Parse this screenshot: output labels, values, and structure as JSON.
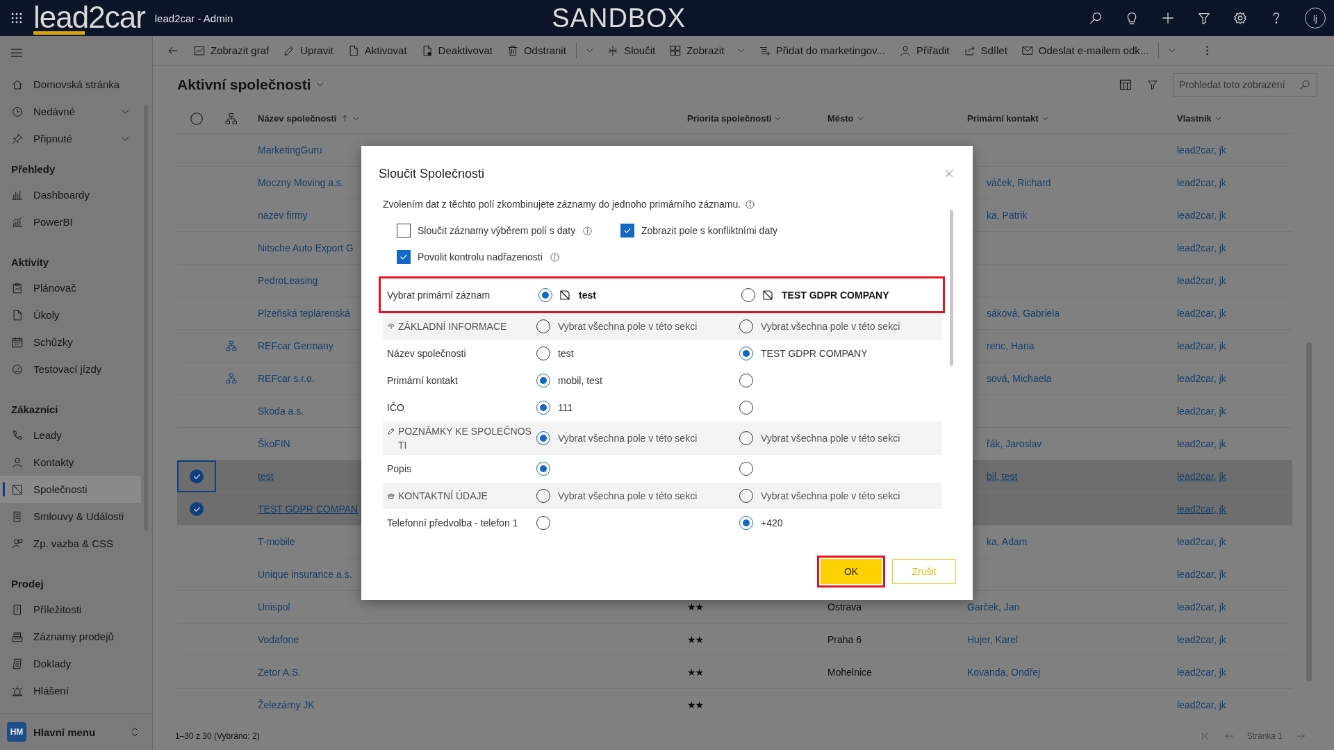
{
  "top_bar": {
    "logo": "lead2car",
    "app_title": "lead2car - Admin",
    "environment": "SANDBOX",
    "avatar": "lj"
  },
  "sidebar": {
    "sections": [
      {
        "items": [
          {
            "label": "Domovská stránka",
            "kind": "link",
            "selected": false
          },
          {
            "label": "Nedávné",
            "kind": "group",
            "selected": false
          },
          {
            "label": "Připnuté",
            "kind": "group",
            "selected": false
          }
        ]
      },
      {
        "title": "Přehledy",
        "items": [
          {
            "label": "Dashboardy",
            "kind": "link",
            "selected": false
          },
          {
            "label": "PowerBI",
            "kind": "link",
            "selected": false
          }
        ]
      },
      {
        "title": "Aktivity",
        "items": [
          {
            "label": "Plánovač",
            "kind": "link",
            "selected": false
          },
          {
            "label": "Úkoly",
            "kind": "link",
            "selected": false
          },
          {
            "label": "Schůzky",
            "kind": "link",
            "selected": false
          },
          {
            "label": "Testovací jízdy",
            "kind": "link",
            "selected": false
          }
        ]
      },
      {
        "title": "Zákazníci",
        "items": [
          {
            "label": "Leady",
            "kind": "link",
            "selected": false
          },
          {
            "label": "Kontakty",
            "kind": "link",
            "selected": false
          },
          {
            "label": "Společnosti",
            "kind": "link",
            "selected": true
          },
          {
            "label": "Smlouvy & Události",
            "kind": "link",
            "selected": false
          },
          {
            "label": "Zp. vazba & CSS",
            "kind": "link",
            "selected": false
          }
        ]
      },
      {
        "title": "Prodej",
        "items": [
          {
            "label": "Příležitosti",
            "kind": "link",
            "selected": false
          },
          {
            "label": "Záznamy prodejů",
            "kind": "link",
            "selected": false
          },
          {
            "label": "Doklady",
            "kind": "link",
            "selected": false
          },
          {
            "label": "Hlášení",
            "kind": "link",
            "selected": false
          }
        ]
      }
    ],
    "footer": {
      "badge": "HM",
      "label": "Hlavní menu"
    }
  },
  "toolbar": {
    "items": [
      {
        "kind": "back"
      },
      {
        "kind": "button",
        "label": "Zobrazit graf"
      },
      {
        "kind": "button",
        "label": "Upravit"
      },
      {
        "kind": "button",
        "label": "Aktivovat"
      },
      {
        "kind": "button",
        "label": "Deaktivovat"
      },
      {
        "kind": "button",
        "label": "Odstranit"
      },
      {
        "kind": "split"
      },
      {
        "kind": "button",
        "label": "Sloučit"
      },
      {
        "kind": "menu",
        "label": "Zobrazit"
      },
      {
        "kind": "button",
        "label": "Přidat do marketingov..."
      },
      {
        "kind": "button",
        "label": "Přiřadit"
      },
      {
        "kind": "button",
        "label": "Sdílet"
      },
      {
        "kind": "button",
        "label": "Odeslat e-mailem odk..."
      },
      {
        "kind": "split"
      },
      {
        "kind": "more"
      }
    ]
  },
  "grid": {
    "view_title": "Aktivní společnosti",
    "search": {
      "placeholder": "Prohledat toto zobrazení"
    },
    "columns": [
      {
        "label": "Název společnosti",
        "sorted": true
      },
      {
        "label": "Priorita společnosti",
        "sorted": false
      },
      {
        "label": "Město",
        "sorted": false
      },
      {
        "label": "Primární kontakt",
        "sorted": false
      },
      {
        "label": "Vlastník",
        "sorted": false
      }
    ],
    "rows": [
      {
        "name": "MarketingGuru",
        "hierarchy": false,
        "selected": false,
        "owner": "lead2car, jk"
      },
      {
        "name": "Moczny Moving a.s.",
        "hierarchy": false,
        "selected": false,
        "contact": "váček, Richard",
        "owner": "lead2car, jk"
      },
      {
        "name": "nazev firmy",
        "hierarchy": false,
        "selected": false,
        "contact": "ka, Patrik",
        "owner": "lead2car, jk"
      },
      {
        "name": "Nitsche Auto Export G",
        "hierarchy": false,
        "selected": false,
        "owner": "lead2car, jk"
      },
      {
        "name": "PedroLeasing",
        "hierarchy": false,
        "selected": false,
        "owner": "lead2car, jk"
      },
      {
        "name": "Plzeňská teplárenská",
        "hierarchy": false,
        "selected": false,
        "contact": "sáková, Gabriela",
        "owner": "lead2car, jk"
      },
      {
        "name": "REFcar Germany",
        "hierarchy": true,
        "selected": false,
        "contact": "renc, Hana",
        "owner": "lead2car, jk"
      },
      {
        "name": "REFcar s.r.o.",
        "hierarchy": true,
        "selected": false,
        "contact": "sová, Michaela",
        "owner": "lead2car, jk"
      },
      {
        "name": "Skoda a.s.",
        "hierarchy": false,
        "selected": false,
        "owner": "lead2car, jk"
      },
      {
        "name": "ŠkoFIN",
        "hierarchy": false,
        "selected": false,
        "contact": "řák, Jaroslav",
        "owner": "lead2car, jk"
      },
      {
        "name": "test",
        "hierarchy": false,
        "selected": true,
        "contact": "bil, test",
        "owner": "lead2car, jk"
      },
      {
        "name": "TEST GDPR COMPAN",
        "hierarchy": false,
        "selected": true,
        "owner": "lead2car, jk"
      },
      {
        "name": "T-mobile",
        "hierarchy": false,
        "selected": false,
        "contact": "ka, Adam",
        "owner": "lead2car, jk"
      },
      {
        "name": "Unique insurance a.s.",
        "hierarchy": false,
        "selected": false,
        "owner": "lead2car, jk"
      },
      {
        "name": "Unispol",
        "hierarchy": false,
        "selected": false,
        "priority": "★★",
        "city": "Ostrava",
        "contact": "Garček, Jan",
        "owner": "lead2car, jk"
      },
      {
        "name": "Vodafone",
        "hierarchy": false,
        "selected": false,
        "priority": "★★",
        "city": "Praha 6",
        "contact": "Hujer, Karel",
        "owner": "lead2car, jk"
      },
      {
        "name": "Zetor A.S.",
        "hierarchy": false,
        "selected": false,
        "priority": "★★",
        "city": "Mohelnice",
        "contact": "Kovanda, Ondřej",
        "owner": "lead2car, jk"
      },
      {
        "name": "Železárny JK",
        "hierarchy": false,
        "selected": false,
        "priority": "★★",
        "owner": "lead2car, jk"
      }
    ],
    "footer": {
      "count": "1–30 z 30 (Vybráno: 2)",
      "page": "Stránka 1"
    }
  },
  "dialog": {
    "title": "Sloučit Společnosti",
    "description": "Zvolením dat z těchto polí zkombinujete záznamy do jednoho primárního záznamu.",
    "options": [
      {
        "label": "Sloučit záznamy výběrem polí s daty",
        "checked": false,
        "info": true
      },
      {
        "label": "Zobrazit pole s konfliktními daty",
        "checked": true,
        "info": false
      },
      {
        "label": "Povolit kontrolu nadřazenosti",
        "checked": true,
        "info": true
      }
    ],
    "primary": {
      "label": "Vybrat primární záznam",
      "highlighted": true,
      "options": [
        {
          "text": "test",
          "selected": true
        },
        {
          "text": "TEST GDPR COMPANY",
          "selected": false
        }
      ]
    },
    "rows": [
      {
        "kind": "section",
        "label": "ZÁKLADNÍ INFORMACE",
        "options": [
          {
            "text": "Vybrat všechna pole v této sekci",
            "selected": false
          },
          {
            "text": "Vybrat všechna pole v této sekci",
            "selected": false
          }
        ]
      },
      {
        "kind": "field",
        "label": "Název společnosti",
        "options": [
          {
            "text": "test",
            "selected": false
          },
          {
            "text": "TEST GDPR COMPANY",
            "selected": true
          }
        ]
      },
      {
        "kind": "field",
        "label": "Primární kontakt",
        "options": [
          {
            "text": "mobil, test",
            "selected": true
          },
          {
            "selected": false
          }
        ]
      },
      {
        "kind": "field",
        "label": "IČO",
        "options": [
          {
            "text": "111",
            "selected": true
          },
          {
            "selected": false
          }
        ]
      },
      {
        "kind": "section",
        "label": "POZNÁMKY KE SPOLEČNOSTI",
        "options": [
          {
            "text": "Vybrat všechna pole v této sekci",
            "selected": true
          },
          {
            "text": "Vybrat všechna pole v této sekci",
            "selected": false
          }
        ]
      },
      {
        "kind": "field",
        "label": "Popis",
        "options": [
          {
            "selected": true
          },
          {
            "selected": false
          }
        ]
      },
      {
        "kind": "section",
        "label": "KONTAKTNÍ ÚDAJE",
        "options": [
          {
            "text": "Vybrat všechna pole v této sekci",
            "selected": false
          },
          {
            "text": "Vybrat všechna pole v této sekci",
            "selected": false
          }
        ]
      },
      {
        "kind": "field",
        "label": "Telefonní předvolba - telefon 1",
        "options": [
          {
            "selected": false
          },
          {
            "text": "+420",
            "selected": true
          }
        ]
      }
    ],
    "buttons": [
      {
        "label": "OK",
        "kind": "primary",
        "highlighted": true
      },
      {
        "label": "Zrušit",
        "kind": "secondary",
        "highlighted": false
      }
    ]
  }
}
